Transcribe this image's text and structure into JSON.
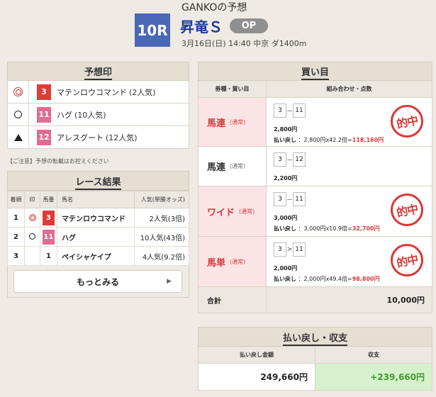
{
  "header": {
    "predictor_title": "GANKOの予想",
    "race_number": "10R",
    "race_name": "昇竜Ｓ",
    "grade": "OP",
    "race_info": "3月16日(日) 14:40 中京 ダ1400m"
  },
  "marks": {
    "title": "予想印",
    "items": [
      {
        "symbol": "double-circle",
        "number": "3",
        "name": "マテンロウコマンド",
        "popularity": "(2人気)",
        "color": "#e23a36"
      },
      {
        "symbol": "circle",
        "number": "11",
        "name": "ハグ",
        "popularity": "(10人気)",
        "color": "#e06c8f"
      },
      {
        "symbol": "triangle",
        "number": "12",
        "name": "アレスグート",
        "popularity": "(12人気)",
        "color": "#e06c8f"
      }
    ]
  },
  "notice": "【ご注意】予想の転載はお控えください",
  "results": {
    "title": "レース結果",
    "headers": {
      "rank": "着順",
      "mark": "印",
      "number": "馬番",
      "name": "馬名",
      "popularity": "人気(単勝オッズ)"
    },
    "rows": [
      {
        "rank": "1",
        "mark": "double-circle",
        "number": "3",
        "name": "マテンロウコマンド",
        "popularity": "2人気(3倍)"
      },
      {
        "rank": "2",
        "mark": "circle",
        "number": "11",
        "name": "ハグ",
        "popularity": "10人気(43倍)"
      },
      {
        "rank": "3",
        "mark": "",
        "number": "1",
        "name": "ペイシャケイプ",
        "popularity": "4人気(9.2倍)"
      }
    ],
    "more_label": "もっとみる"
  },
  "bets": {
    "title": "買い目",
    "col_type": "券種・買い目",
    "col_combo": "組み合わせ・点数",
    "rows": [
      {
        "type": "馬連",
        "note": "(通常)",
        "a": "3",
        "sep": "－",
        "b": "11",
        "stake": "2,800円",
        "payout_label": "払い戻し",
        "payout_calc": "：2,800円x42.2倍=",
        "payout_result": "118,160円",
        "hit": true
      },
      {
        "type": "馬連",
        "note": "(通常)",
        "a": "3",
        "sep": "－",
        "b": "12",
        "stake": "2,200円",
        "hit": false
      },
      {
        "type": "ワイド",
        "note": "(通常)",
        "a": "3",
        "sep": "－",
        "b": "11",
        "stake": "3,000円",
        "payout_label": "払い戻し",
        "payout_calc": "：3,000円x10.9倍=",
        "payout_result": "32,700円",
        "hit": true
      },
      {
        "type": "馬単",
        "note": "(通常)",
        "a": "3",
        "sep": ">",
        "b": "11",
        "stake": "2,000円",
        "payout_label": "払い戻し",
        "payout_calc": "：2,000円x49.4倍=",
        "payout_result": "98,800円",
        "hit": true
      }
    ],
    "stamp_text": "的中",
    "total_label": "合計",
    "total_value": "10,000円"
  },
  "payback": {
    "title": "払い戻し・収支",
    "col_amount": "払い戻し金額",
    "col_balance": "収支",
    "amount": "249,660円",
    "balance": "+239,660円"
  },
  "colors": {
    "race_number_bg": "#4a68b6",
    "race_name": "#1e3c96",
    "hit_red": "#d83a3a",
    "balance_green": "#3c9c2c"
  }
}
